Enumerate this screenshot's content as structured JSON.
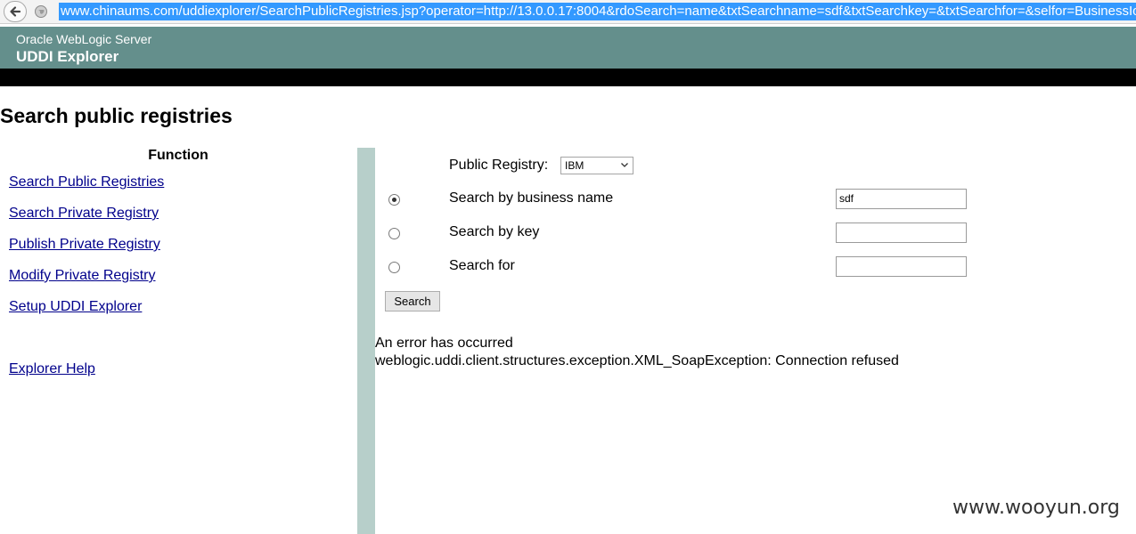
{
  "browser": {
    "url": "www.chinaums.com/uddiexplorer/SearchPublicRegistries.jsp?operator=http://13.0.0.17:8004&rdoSearch=name&txtSearchname=sdf&txtSearchkey=&txtSearchfor=&selfor=BusinessIo"
  },
  "banner": {
    "product": "Oracle WebLogic Server",
    "app": "UDDI Explorer"
  },
  "page": {
    "title": "Search public registries"
  },
  "menu": {
    "heading": "Function",
    "items": [
      {
        "label": "Search Public Registries"
      },
      {
        "label": "Search Private Registry"
      },
      {
        "label": "Publish Private Registry"
      },
      {
        "label": "Modify Private Registry"
      },
      {
        "label": "Setup UDDI Explorer"
      },
      {
        "label": "Explorer Help"
      }
    ]
  },
  "form": {
    "registry_label": "Public Registry:",
    "registry_value": "IBM",
    "options": [
      {
        "label": "Search by business name",
        "value": "sdf",
        "selected": true
      },
      {
        "label": "Search by key",
        "value": "",
        "selected": false
      },
      {
        "label": "Search for",
        "value": "",
        "selected": false
      }
    ],
    "search_button": "Search"
  },
  "error": {
    "title": "An error has occurred",
    "message": "weblogic.uddi.client.structures.exception.XML_SoapException: Connection refused"
  },
  "watermark": "www.wooyun.org"
}
